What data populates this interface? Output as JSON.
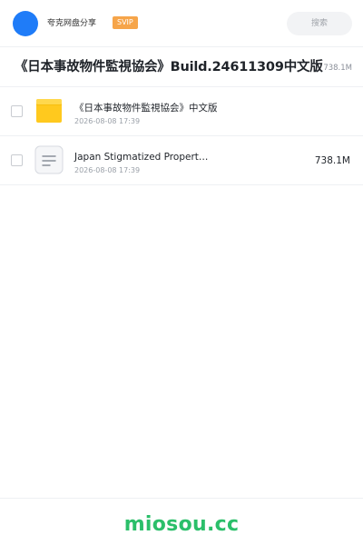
{
  "header": {
    "user_name": "夸克网盘分享",
    "badge": "SVIP",
    "search_placeholder": "搜索"
  },
  "share": {
    "title": "《日本事故物件監視協会》Build.24611309中文版",
    "total_size": "738.1M"
  },
  "items": [
    {
      "icon": "folder-icon",
      "name": "《日本事故物件監視協会》中文版",
      "date": "2026-08-08 17:39",
      "size": ""
    },
    {
      "icon": "document-icon",
      "name": "Japan Stigmatized Propert…",
      "date": "2026-08-08 17:39",
      "size": "738.1M"
    }
  ],
  "footer": {
    "brand": "miosou.cc"
  },
  "colors": {
    "avatar": "#1f7cf8",
    "badge": "#f6a54a",
    "folder": "#ffc91e",
    "brand": "#2bbf6a"
  }
}
